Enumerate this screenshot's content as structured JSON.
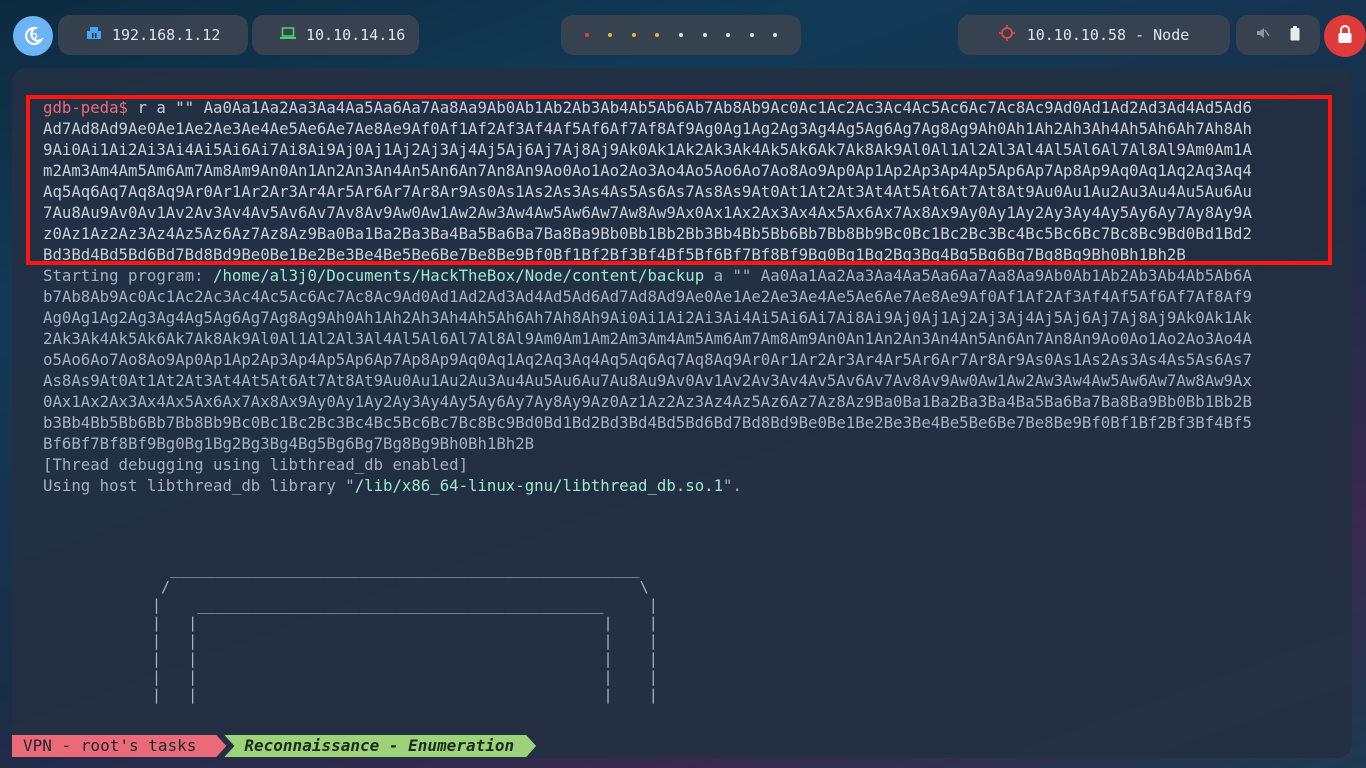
{
  "topbar": {
    "vpn_ip": "192.168.1.12",
    "tun_ip": "10.10.14.16",
    "target": "10.10.10.58 - Node",
    "workspace_dot_colors": [
      "red",
      "yellow",
      "yellow",
      "yellow",
      "white",
      "white",
      "white",
      "white",
      "white"
    ]
  },
  "terminal": {
    "prompt": "gdb-peda$",
    "command": " r a \"\" Aa0Aa1Aa2Aa3Aa4Aa5Aa6Aa7Aa8Aa9Ab0Ab1Ab2Ab3Ab4Ab5Ab6Ab7Ab8Ab9Ac0Ac1Ac2Ac3Ac4Ac5Ac6Ac7Ac8Ac9Ad0Ad1Ad2Ad3Ad4Ad5Ad6",
    "command_wrap": [
      "Ad7Ad8Ad9Ae0Ae1Ae2Ae3Ae4Ae5Ae6Ae7Ae8Ae9Af0Af1Af2Af3Af4Af5Af6Af7Af8Af9Ag0Ag1Ag2Ag3Ag4Ag5Ag6Ag7Ag8Ag9Ah0Ah1Ah2Ah3Ah4Ah5Ah6Ah7Ah8Ah",
      "9Ai0Ai1Ai2Ai3Ai4Ai5Ai6Ai7Ai8Ai9Aj0Aj1Aj2Aj3Aj4Aj5Aj6Aj7Aj8Aj9Ak0Ak1Ak2Ak3Ak4Ak5Ak6Ak7Ak8Ak9Al0Al1Al2Al3Al4Al5Al6Al7Al8Al9Am0Am1A",
      "m2Am3Am4Am5Am6Am7Am8Am9An0An1An2An3An4An5An6An7An8An9Ao0Ao1Ao2Ao3Ao4Ao5Ao6Ao7Ao8Ao9Ap0Ap1Ap2Ap3Ap4Ap5Ap6Ap7Ap8Ap9Aq0Aq1Aq2Aq3Aq4",
      "Aq5Aq6Aq7Aq8Aq9Ar0Ar1Ar2Ar3Ar4Ar5Ar6Ar7Ar8Ar9As0As1As2As3As4As5As6As7As8As9At0At1At2At3At4At5At6At7At8At9Au0Au1Au2Au3Au4Au5Au6Au",
      "7Au8Au9Av0Av1Av2Av3Av4Av5Av6Av7Av8Av9Aw0Aw1Aw2Aw3Aw4Aw5Aw6Aw7Aw8Aw9Ax0Ax1Ax2Ax3Ax4Ax5Ax6Ax7Ax8Ax9Ay0Ay1Ay2Ay3Ay4Ay5Ay6Ay7Ay8Ay9A",
      "z0Az1Az2Az3Az4Az5Az6Az7Az8Az9Ba0Ba1Ba2Ba3Ba4Ba5Ba6Ba7Ba8Ba9Bb0Bb1Bb2Bb3Bb4Bb5Bb6Bb7Bb8Bb9Bc0Bc1Bc2Bc3Bc4Bc5Bc6Bc7Bc8Bc9Bd0Bd1Bd2",
      "Bd3Bd4Bd5Bd6Bd7Bd8Bd9Be0Be1Be2Be3Be4Be5Be6Be7Be8Be9Bf0Bf1Bf2Bf3Bf4Bf5Bf6Bf7Bf8Bf9Bg0Bg1Bg2Bg3Bg4Bg5Bg6Bg7Bg8Bg9Bh0Bh1Bh2B"
    ],
    "starting_label": "Starting program: ",
    "program_path": "/home/al3j0/Documents/HackTheBox/Node/content/backup",
    "starting_args": " a \"\" Aa0Aa1Aa2Aa3Aa4Aa5Aa6Aa7Aa8Aa9Ab0Ab1Ab2Ab3Ab4Ab5Ab6A",
    "program_wrap": [
      "b7Ab8Ab9Ac0Ac1Ac2Ac3Ac4Ac5Ac6Ac7Ac8Ac9Ad0Ad1Ad2Ad3Ad4Ad5Ad6Ad7Ad8Ad9Ae0Ae1Ae2Ae3Ae4Ae5Ae6Ae7Ae8Ae9Af0Af1Af2Af3Af4Af5Af6Af7Af8Af9",
      "Ag0Ag1Ag2Ag3Ag4Ag5Ag6Ag7Ag8Ag9Ah0Ah1Ah2Ah3Ah4Ah5Ah6Ah7Ah8Ah9Ai0Ai1Ai2Ai3Ai4Ai5Ai6Ai7Ai8Ai9Aj0Aj1Aj2Aj3Aj4Aj5Aj6Aj7Aj8Aj9Ak0Ak1Ak",
      "2Ak3Ak4Ak5Ak6Ak7Ak8Ak9Al0Al1Al2Al3Al4Al5Al6Al7Al8Al9Am0Am1Am2Am3Am4Am5Am6Am7Am8Am9An0An1An2An3An4An5An6An7An8An9Ao0Ao1Ao2Ao3Ao4A",
      "o5Ao6Ao7Ao8Ao9Ap0Ap1Ap2Ap3Ap4Ap5Ap6Ap7Ap8Ap9Aq0Aq1Aq2Aq3Aq4Aq5Aq6Aq7Aq8Aq9Ar0Ar1Ar2Ar3Ar4Ar5Ar6Ar7Ar8Ar9As0As1As2As3As4As5As6As7",
      "As8As9At0At1At2At3At4At5At6At7At8At9Au0Au1Au2Au3Au4Au5Au6Au7Au8Au9Av0Av1Av2Av3Av4Av5Av6Av7Av8Av9Aw0Aw1Aw2Aw3Aw4Aw5Aw6Aw7Aw8Aw9Ax",
      "0Ax1Ax2Ax3Ax4Ax5Ax6Ax7Ax8Ax9Ay0Ay1Ay2Ay3Ay4Ay5Ay6Ay7Ay8Ay9Az0Az1Az2Az3Az4Az5Az6Az7Az8Az9Ba0Ba1Ba2Ba3Ba4Ba5Ba6Ba7Ba8Ba9Bb0Bb1Bb2B",
      "b3Bb4Bb5Bb6Bb7Bb8Bb9Bc0Bc1Bc2Bc3Bc4Bc5Bc6Bc7Bc8Bc9Bd0Bd1Bd2Bd3Bd4Bd5Bd6Bd7Bd8Bd9Be0Be1Be2Be3Be4Be5Be6Be7Be8Be9Bf0Bf1Bf2Bf3Bf4Bf5",
      "Bf6Bf7Bf8Bf9Bg0Bg1Bg2Bg3Bg4Bg5Bg6Bg7Bg8Bg9Bh0Bh1Bh2B"
    ],
    "thread_line": "[Thread debugging using libthread_db enabled]",
    "host_line_prefix": "Using host libthread_db library \"",
    "host_line_path": "/lib/x86_64-linux-gnu/libthread_db.so.1",
    "host_line_suffix": "\".",
    "ascii_art": "  ____________________________________________________\n /                                                    \\\n|    _____________________________________________     |\n|   |                                             |    |\n|   |                                             |    |\n|   |                                             |    |\n|   |                                             |    |\n|   |                                             |    |"
  },
  "statusbar": {
    "session": "VPN - root's tasks",
    "window": "Reconnaissance - Enumeration"
  },
  "colors": {
    "highlight_box": "#ff1414",
    "prompt": "#ef6a7e",
    "path": "#9fe8d0"
  }
}
